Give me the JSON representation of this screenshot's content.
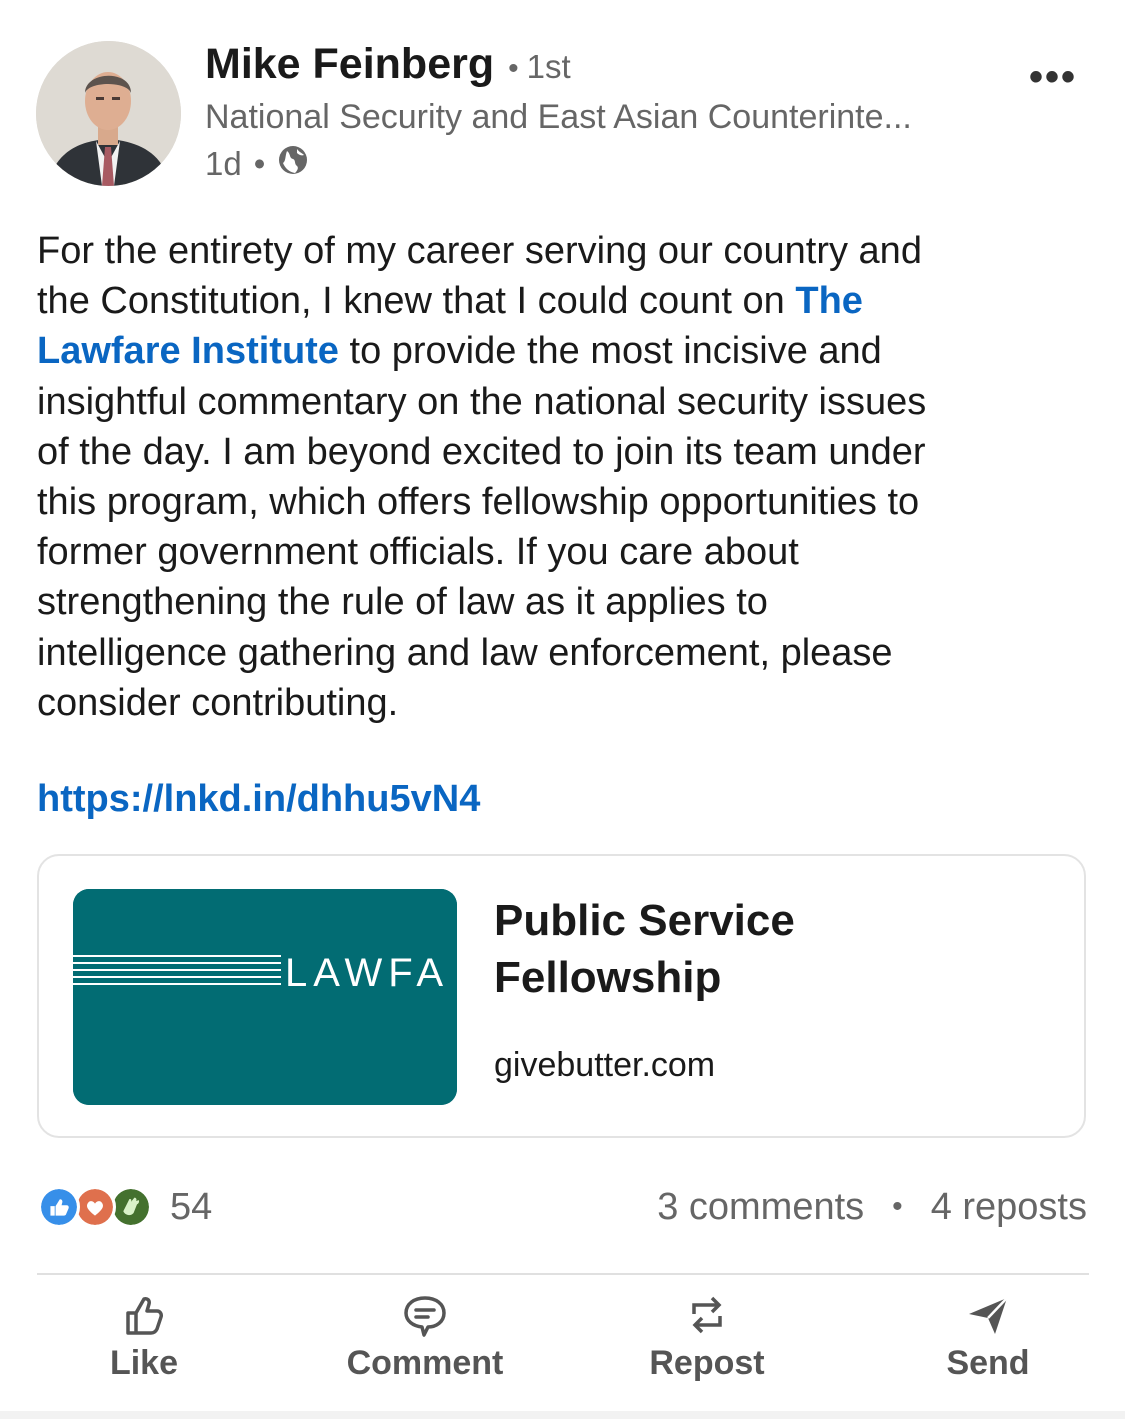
{
  "author": {
    "name": "Mike Feinberg",
    "connection_degree": "1st",
    "headline": "National Security and East Asian Counterinte...",
    "time": "1d",
    "visibility_icon": "globe-icon"
  },
  "post": {
    "lines": [
      [
        {
          "text": "For the entirety of my career serving our country and"
        }
      ],
      [
        {
          "text": "the Constitution, I knew that I could count on "
        },
        {
          "text": "The",
          "mention": true
        }
      ],
      [
        {
          "text": "Lawfare Institute",
          "mention": true
        },
        {
          "text": " to provide the most incisive and"
        }
      ],
      [
        {
          "text": "insightful commentary on the national security issues"
        }
      ],
      [
        {
          "text": "of the day.  I am beyond excited to join its team under"
        }
      ],
      [
        {
          "text": "this program, which offers fellowship opportunities to"
        }
      ],
      [
        {
          "text": "former government officials.  If you care about"
        }
      ],
      [
        {
          "text": "strengthening the rule of law as it applies to"
        }
      ],
      [
        {
          "text": "intelligence gathering and law enforcement, please"
        }
      ],
      [
        {
          "text": "consider contributing."
        }
      ]
    ],
    "link": "https://lnkd.in/dhhu5vN4"
  },
  "link_preview": {
    "image_text": "LAWFA",
    "title_line1": "Public Service",
    "title_line2": "Fellowship",
    "domain": "givebutter.com"
  },
  "social": {
    "reaction_icons": [
      "like-reaction-icon",
      "love-reaction-icon",
      "celebrate-reaction-icon"
    ],
    "reaction_count": "54",
    "comments": "3 comments",
    "reposts": "4 reposts"
  },
  "actions": {
    "like": "Like",
    "comment": "Comment",
    "repost": "Repost",
    "send": "Send"
  },
  "colors": {
    "link_blue": "#0a66c2",
    "card_image_teal": "#026c73",
    "secondary_text": "#666666"
  }
}
